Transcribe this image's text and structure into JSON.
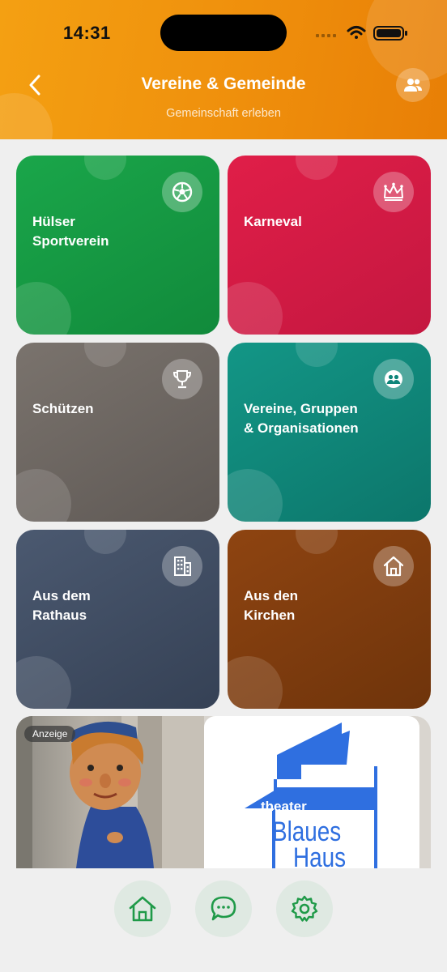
{
  "status_bar": {
    "time": "14:31"
  },
  "header": {
    "title": "Vereine & Gemeinde",
    "subtitle": "Gemeinschaft erleben",
    "back_icon": "chevron-left-icon",
    "people_icon": "people-icon"
  },
  "tiles": [
    {
      "label": "Hülser\nSportverein",
      "icon": "soccer-ball-icon",
      "color": "#1aa64a"
    },
    {
      "label": "Karneval",
      "icon": "crown-icon",
      "color": "#e01e48"
    },
    {
      "label": "Schützen",
      "icon": "trophy-icon",
      "color": "#7a736d"
    },
    {
      "label": "Vereine, Gruppen\n& Organisationen",
      "icon": "group-icon",
      "color": "#139686"
    },
    {
      "label": "Aus dem\nRathaus",
      "icon": "building-icon",
      "color": "#4b5970"
    },
    {
      "label": "Aus den\nKirchen",
      "icon": "church-house-icon",
      "color": "#8e4411"
    }
  ],
  "ad": {
    "badge": "Anzeige",
    "logo_line1": "theater",
    "logo_line2": "Blaues",
    "logo_line3": "Haus"
  },
  "bottom_nav": [
    {
      "icon": "home-icon"
    },
    {
      "icon": "chat-icon"
    },
    {
      "icon": "settings-icon"
    }
  ],
  "colors": {
    "accent": "#f4a012",
    "nav_icon": "#1f9a48"
  }
}
